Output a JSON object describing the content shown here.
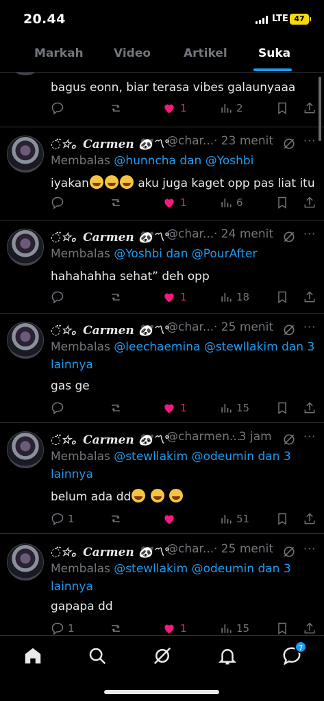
{
  "status_bar": {
    "time": "20.44",
    "network": "LTE",
    "battery": "47"
  },
  "tabs": [
    {
      "label": "Markah"
    },
    {
      "label": "Video"
    },
    {
      "label": "Artikel"
    },
    {
      "label": "Suka",
      "active": true
    }
  ],
  "posts": [
    {
      "text": "bagus eonn, biar terasa vibes galaunyaaa",
      "actions": {
        "reply": "",
        "retweet": "",
        "like": "1",
        "views": "2"
      }
    },
    {
      "name": "◌̈☆。𝑪𝒂𝒓𝒎𝒆𝒏 🐼〽°",
      "handle": "@char...",
      "time": "· 23 menit",
      "reply_prefix": "Membalas ",
      "reply_mentions": "@hunncha dan @Yoshbi",
      "text": "iyakan",
      "text_suffix": " aku juga kaget opp pas liat itu",
      "emoji_count": 3,
      "actions": {
        "reply": "",
        "retweet": "",
        "like": "1",
        "views": "6"
      }
    },
    {
      "name": "◌̈☆。𝑪𝒂𝒓𝒎𝒆𝒏 🐼〽°",
      "handle": "@char...",
      "time": "· 24 menit",
      "reply_prefix": "Membalas ",
      "reply_mentions": "@Yoshbi dan @PourAfter",
      "text": "hahahahha sehat” deh opp",
      "actions": {
        "reply": "",
        "retweet": "",
        "like": "1",
        "views": "18"
      }
    },
    {
      "name": "◌̈☆。𝑪𝒂𝒓𝒎𝒆𝒏 🐼〽°",
      "handle": "@char...",
      "time": "· 25 menit",
      "reply_prefix": "Membalas ",
      "reply_mentions": "@leechaemina @stewllakim dan 3 lainnya",
      "text": "gas ge",
      "actions": {
        "reply": "",
        "retweet": "",
        "like": "1",
        "views": "15"
      }
    },
    {
      "name": "◌̈☆。𝑪𝒂𝒓𝒎𝒆𝒏 🐼〽°",
      "handle": "@charmen...",
      "time": "· 3 jam",
      "reply_prefix": "Membalas ",
      "reply_mentions": "@stewllakim @odeumin dan 3 lainnya",
      "text": "belum ada dd",
      "emoji_count": 3,
      "actions": {
        "reply": "1",
        "retweet": "",
        "like": "",
        "views": "51"
      }
    },
    {
      "name": "◌̈☆。𝑪𝒂𝒓𝒎𝒆𝒏 🐼〽°",
      "handle": "@char...",
      "time": "· 25 menit",
      "reply_prefix": "Membalas ",
      "reply_mentions": "@stewllakim @odeumin dan 3 lainnya",
      "text": "gapapa dd",
      "actions": {
        "reply": "1",
        "retweet": "",
        "like": "1",
        "views": "15"
      }
    }
  ],
  "nav": {
    "messages_badge": "7"
  },
  "colors": {
    "accent": "#1d9bf0",
    "like": "#f91880",
    "muted": "#71767b"
  }
}
